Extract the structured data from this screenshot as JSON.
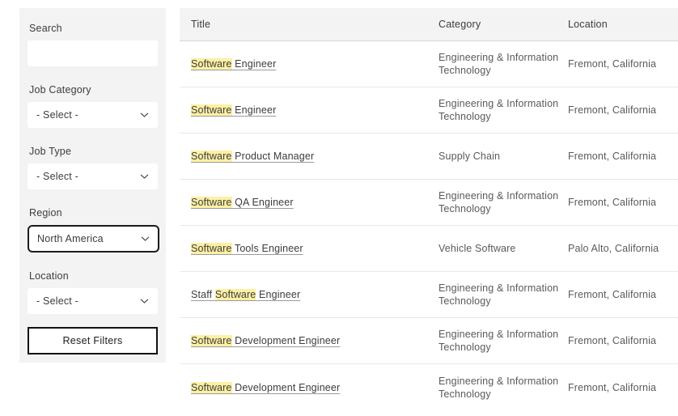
{
  "sidebar": {
    "search": {
      "label": "Search",
      "value": "",
      "placeholder": ""
    },
    "job_category": {
      "label": "Job Category",
      "value": "- Select -"
    },
    "job_type": {
      "label": "Job Type",
      "value": "- Select -"
    },
    "region": {
      "label": "Region",
      "value": "North America",
      "focused": true
    },
    "location": {
      "label": "Location",
      "value": "- Select -"
    },
    "reset_button": "Reset Filters"
  },
  "table": {
    "columns": [
      "Title",
      "Category",
      "Location"
    ],
    "rows": [
      {
        "title_prefix": "",
        "title_highlight": "Software",
        "title_suffix": " Engineer",
        "category": "Engineering & Information Technology",
        "location": "Fremont, California"
      },
      {
        "title_prefix": "",
        "title_highlight": "Software",
        "title_suffix": " Engineer",
        "category": "Engineering & Information Technology",
        "location": "Fremont, California"
      },
      {
        "title_prefix": "",
        "title_highlight": "Software",
        "title_suffix": " Product Manager",
        "category": "Supply Chain",
        "location": "Fremont, California"
      },
      {
        "title_prefix": "",
        "title_highlight": "Software",
        "title_suffix": " QA Engineer",
        "category": "Engineering & Information Technology",
        "location": "Fremont, California"
      },
      {
        "title_prefix": "",
        "title_highlight": "Software",
        "title_suffix": " Tools Engineer",
        "category": "Vehicle Software",
        "location": "Palo Alto, California"
      },
      {
        "title_prefix": "Staff ",
        "title_highlight": "Software",
        "title_suffix": " Engineer",
        "category": "Engineering & Information Technology",
        "location": "Fremont, California"
      },
      {
        "title_prefix": "",
        "title_highlight": "Software",
        "title_suffix": " Development Engineer",
        "category": "Engineering & Information Technology",
        "location": "Fremont, California"
      },
      {
        "title_prefix": "",
        "title_highlight": "Software",
        "title_suffix": " Development Engineer",
        "category": "Engineering & Information Technology",
        "location": "Fremont, California"
      }
    ]
  },
  "colors": {
    "highlight": "#fdf0a4",
    "sidebar_bg": "#f3f3f3",
    "header_bg": "#f3f3f3",
    "focus_border": "#1c1c1c",
    "button_border": "#111111"
  }
}
